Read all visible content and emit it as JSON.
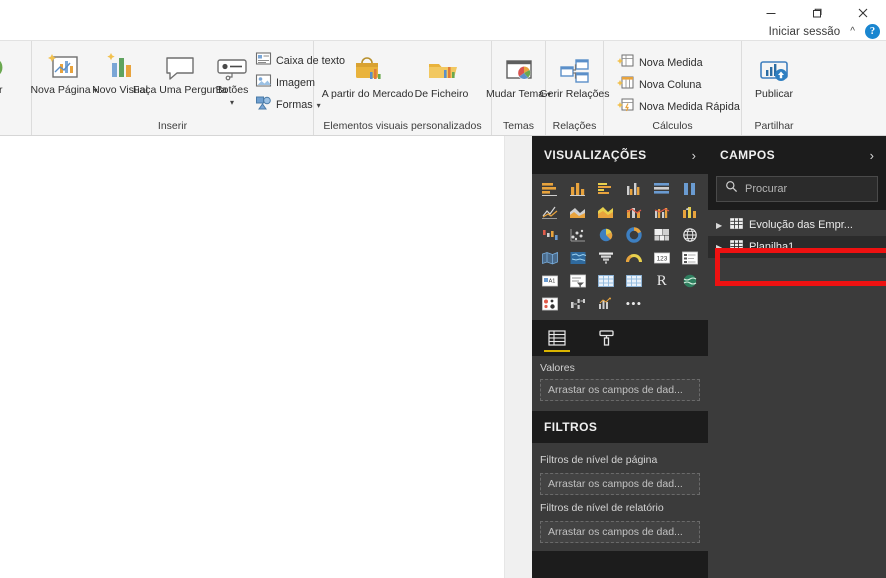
{
  "titlebar": {
    "minimize_label": "minimize",
    "restore_label": "restore",
    "close_label": "close",
    "signin_label": "Iniciar sessão",
    "caret_label": "^",
    "help_label": "?"
  },
  "ribbon": {
    "groups": [
      {
        "label": "",
        "items": [
          {
            "label": "izar",
            "icon": "refresh-icon",
            "dropdown": false
          }
        ]
      },
      {
        "label": "Inserir",
        "items": [
          {
            "label": "Nova Página",
            "icon": "new-page-icon",
            "dropdown": true
          },
          {
            "label": "Novo Visual",
            "icon": "new-visual-icon",
            "dropdown": false
          },
          {
            "label": "Faça Uma Pergunta",
            "icon": "ask-question-icon",
            "dropdown": false
          },
          {
            "label": "Botões",
            "icon": "buttons-icon",
            "dropdown": true
          }
        ],
        "small_items": [
          {
            "label": "Caixa de texto",
            "icon": "textbox-icon",
            "dropdown": false
          },
          {
            "label": "Imagem",
            "icon": "image-icon",
            "dropdown": false
          },
          {
            "label": "Formas",
            "icon": "shapes-icon",
            "dropdown": true
          }
        ]
      },
      {
        "label": "Elementos visuais personalizados",
        "items": [
          {
            "label": "A partir do Mercado",
            "icon": "marketplace-icon",
            "dropdown": false
          },
          {
            "label": "De Ficheiro",
            "icon": "from-file-icon",
            "dropdown": false
          }
        ]
      },
      {
        "label": "Temas",
        "items": [
          {
            "label": "Mudar Tema",
            "icon": "switch-theme-icon",
            "dropdown": true
          }
        ]
      },
      {
        "label": "Relações",
        "items": [
          {
            "label": "Gerir Relações",
            "icon": "manage-relationships-icon",
            "dropdown": false
          }
        ]
      },
      {
        "label": "Cálculos",
        "items": [],
        "small_items": [
          {
            "label": "Nova Medida",
            "icon": "new-measure-icon",
            "dropdown": false
          },
          {
            "label": "Nova Coluna",
            "icon": "new-column-icon",
            "dropdown": false
          },
          {
            "label": "Nova Medida Rápida",
            "icon": "new-quick-measure-icon",
            "dropdown": false
          }
        ]
      },
      {
        "label": "Partilhar",
        "items": [
          {
            "label": "Publicar",
            "icon": "publish-icon",
            "dropdown": false
          }
        ]
      }
    ]
  },
  "visualizations": {
    "title": "VISUALIZAÇÕES",
    "expand_chevron": "›",
    "icons": [
      "stacked-bar-chart-icon",
      "stacked-column-chart-icon",
      "clustered-bar-chart-icon",
      "clustered-column-chart-icon",
      "100-stacked-bar-chart-icon",
      "100-stacked-column-chart-icon",
      "line-chart-icon",
      "area-chart-icon",
      "stacked-area-chart-icon",
      "line-stacked-column-chart-icon",
      "line-clustered-column-chart-icon",
      "ribbon-chart-icon",
      "waterfall-chart-icon",
      "scatter-chart-icon",
      "pie-chart-icon",
      "donut-chart-icon",
      "treemap-icon",
      "map-icon",
      "filled-map-icon",
      "shape-map-icon",
      "funnel-chart-icon",
      "gauge-chart-icon",
      "card-icon",
      "multi-row-card-icon",
      "kpi-icon",
      "slicer-icon",
      "table-icon",
      "matrix-icon",
      "r-script-visual-icon",
      "arcgis-map-icon",
      "key-influencers-icon",
      "decomposition-tree-icon",
      "python-visual-icon",
      "more-options-icon"
    ],
    "tabs": [
      {
        "name": "fields-tab",
        "icon": "fields-well-icon",
        "active": true
      },
      {
        "name": "format-tab",
        "icon": "paint-roller-icon",
        "active": false
      }
    ],
    "wells": [
      {
        "title": "Valores",
        "placeholder": "Arrastar os campos de dad..."
      }
    ]
  },
  "filters": {
    "title": "FILTROS",
    "sections": [
      {
        "label": "Filtros de nível de página",
        "placeholder": "Arrastar os campos de dad..."
      },
      {
        "label": "Filtros de nível de relatório",
        "placeholder": "Arrastar os campos de dad..."
      }
    ]
  },
  "fields": {
    "title": "CAMPOS",
    "expand_chevron": "›",
    "search_placeholder": "Procurar",
    "search_icon": "search-icon",
    "items": [
      {
        "label": "Evolução das Empr...",
        "icon": "table-field-icon",
        "expanded": false,
        "selected": false
      },
      {
        "label": "Planilha1",
        "icon": "table-field-icon",
        "expanded": false,
        "selected": true
      }
    ],
    "highlight_color": "#ee1111",
    "highlight_target": "Planilha1"
  }
}
